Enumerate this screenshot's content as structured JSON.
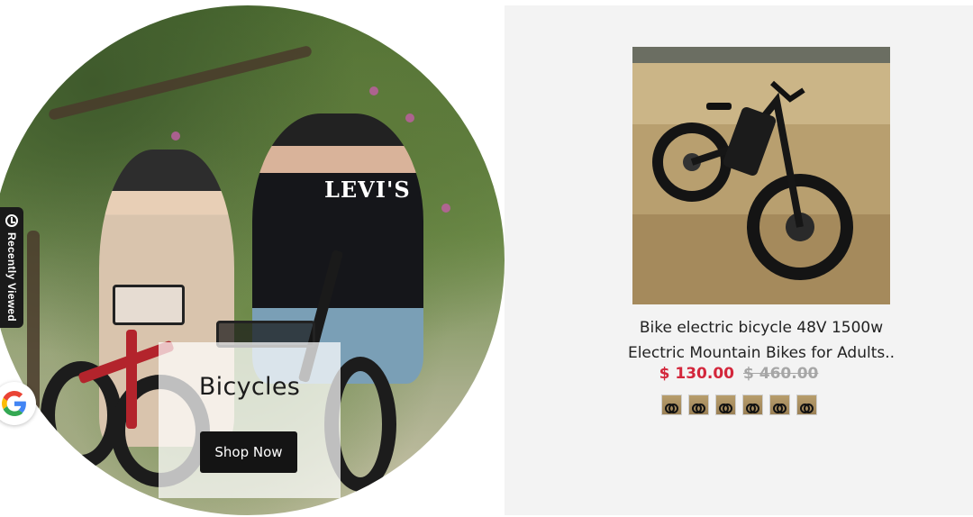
{
  "hero": {
    "hoodie_print": "LEVI'S",
    "category_title": "Bicycles",
    "cta_label": "Shop Now"
  },
  "sidebar": {
    "recently_viewed_label": "Recently Viewed",
    "recently_icon": "recent-eye-icon",
    "google_icon": "google-g-icon"
  },
  "product": {
    "title_line1": "Bike electric bicycle 48V 1500w",
    "title_line2": "Electric Mountain Bikes for Adults..",
    "sale_price": "$ 130.00",
    "regular_price": "$ 460.00",
    "sale_color": "#d3263b",
    "thumbnail_count": 6
  }
}
